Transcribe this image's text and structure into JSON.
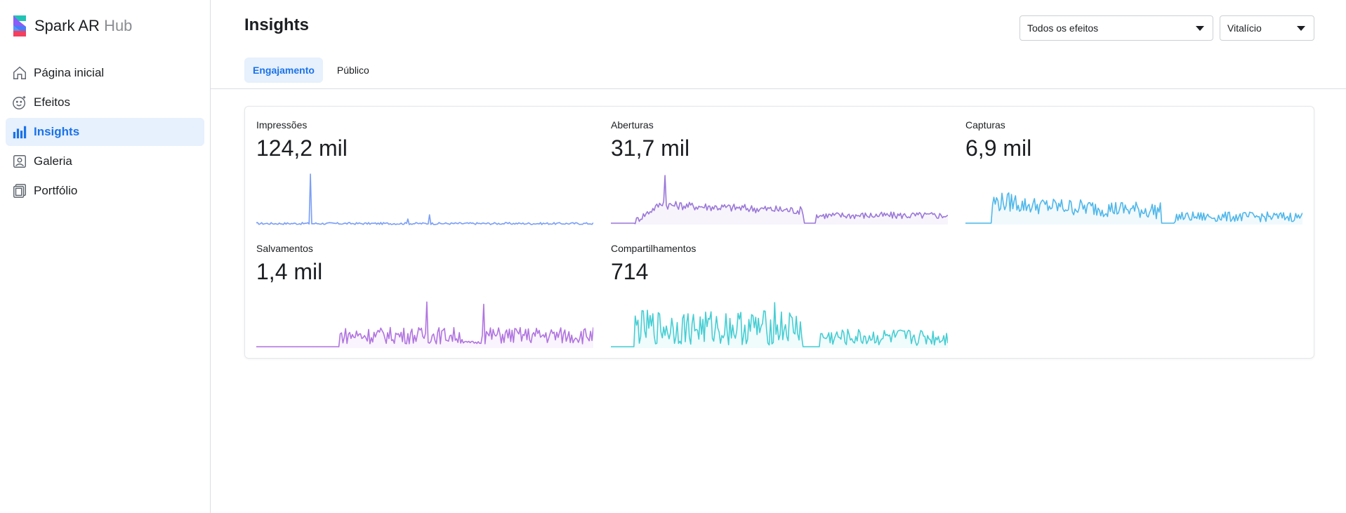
{
  "brand": {
    "name": "Spark AR",
    "suffix": "Hub"
  },
  "sidebar": {
    "items": [
      {
        "label": "Página inicial",
        "icon": "home-icon",
        "active": false
      },
      {
        "label": "Efeitos",
        "icon": "smiley-icon",
        "active": false
      },
      {
        "label": "Insights",
        "icon": "bar-chart-icon",
        "active": true
      },
      {
        "label": "Galeria",
        "icon": "gallery-icon",
        "active": false
      },
      {
        "label": "Portfólio",
        "icon": "portfolio-icon",
        "active": false
      }
    ]
  },
  "header": {
    "title": "Insights",
    "filters": {
      "effects": "Todos os efeitos",
      "period": "Vitalício"
    },
    "tabs": [
      {
        "label": "Engajamento",
        "active": true
      },
      {
        "label": "Público",
        "active": false
      }
    ]
  },
  "metrics": [
    {
      "label": "Impressões",
      "value": "124,2 mil",
      "color": "#7b9ff5"
    },
    {
      "label": "Aberturas",
      "value": "31,7 mil",
      "color": "#9b78d8"
    },
    {
      "label": "Capturas",
      "value": "6,9 mil",
      "color": "#4fb7ea"
    },
    {
      "label": "Salvamentos",
      "value": "1,4 mil",
      "color": "#b174e0"
    },
    {
      "label": "Compartilhamentos",
      "value": "714",
      "color": "#45ced3"
    }
  ],
  "colors": {
    "accent": "#1a73e8",
    "active_bg": "#e7f0fd"
  }
}
